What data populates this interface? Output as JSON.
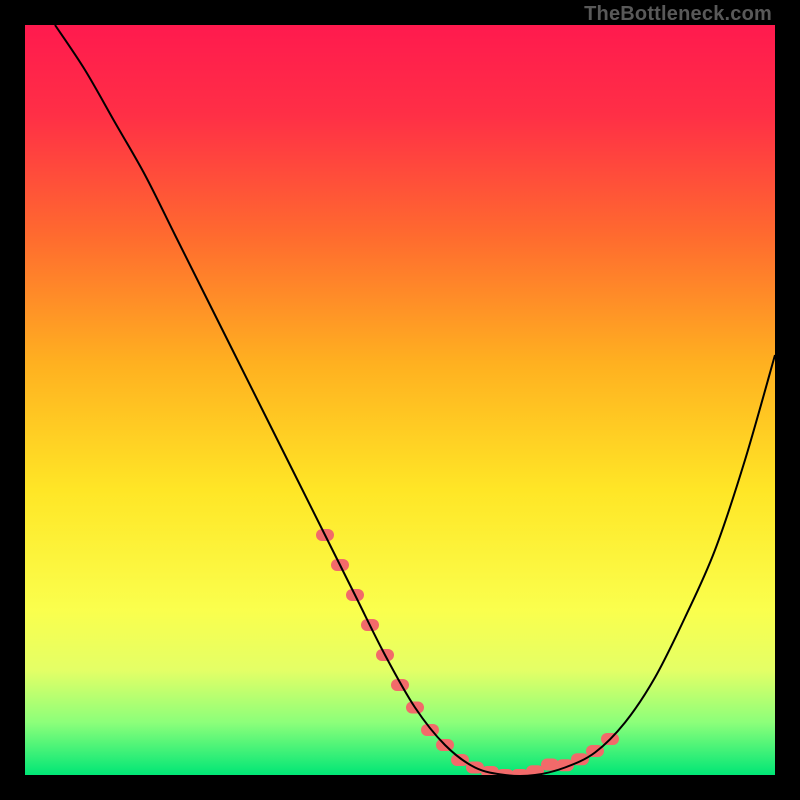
{
  "watermark": "TheBottleneck.com",
  "colors": {
    "frame": "#000000",
    "gradient_stops": [
      {
        "offset": 0.0,
        "color": "#ff1a4e"
      },
      {
        "offset": 0.12,
        "color": "#ff2f46"
      },
      {
        "offset": 0.28,
        "color": "#ff6a2f"
      },
      {
        "offset": 0.45,
        "color": "#ffb020"
      },
      {
        "offset": 0.62,
        "color": "#ffe626"
      },
      {
        "offset": 0.78,
        "color": "#faff4d"
      },
      {
        "offset": 0.86,
        "color": "#e4ff66"
      },
      {
        "offset": 0.93,
        "color": "#8cff7a"
      },
      {
        "offset": 1.0,
        "color": "#00e676"
      }
    ],
    "curve": "#000000",
    "marker": "#f26a6a"
  },
  "chart_data": {
    "type": "line",
    "title": "",
    "xlabel": "",
    "ylabel": "",
    "xlim": [
      0,
      100
    ],
    "ylim": [
      0,
      100
    ],
    "grid": false,
    "legend": false,
    "series": [
      {
        "name": "bottleneck-curve",
        "x": [
          4,
          8,
          12,
          16,
          20,
          24,
          28,
          32,
          36,
          40,
          44,
          48,
          52,
          56,
          60,
          64,
          68,
          72,
          76,
          80,
          84,
          88,
          92,
          96,
          100
        ],
        "y": [
          100,
          94,
          87,
          80,
          72,
          64,
          56,
          48,
          40,
          32,
          24,
          16,
          9,
          4,
          1,
          0,
          0,
          1,
          3,
          7,
          13,
          21,
          30,
          42,
          56
        ]
      }
    ],
    "markers": {
      "name": "highlight-points",
      "x": [
        40,
        42,
        44,
        46,
        48,
        50,
        52,
        54,
        56,
        58,
        60,
        62,
        64,
        66,
        68,
        70,
        72,
        74,
        76,
        78
      ],
      "y": [
        32,
        28,
        24,
        20,
        16,
        12,
        9,
        6,
        4,
        2,
        1,
        0.4,
        0,
        0,
        0.5,
        1.4,
        1.3,
        2.1,
        3.2,
        4.8
      ]
    }
  }
}
